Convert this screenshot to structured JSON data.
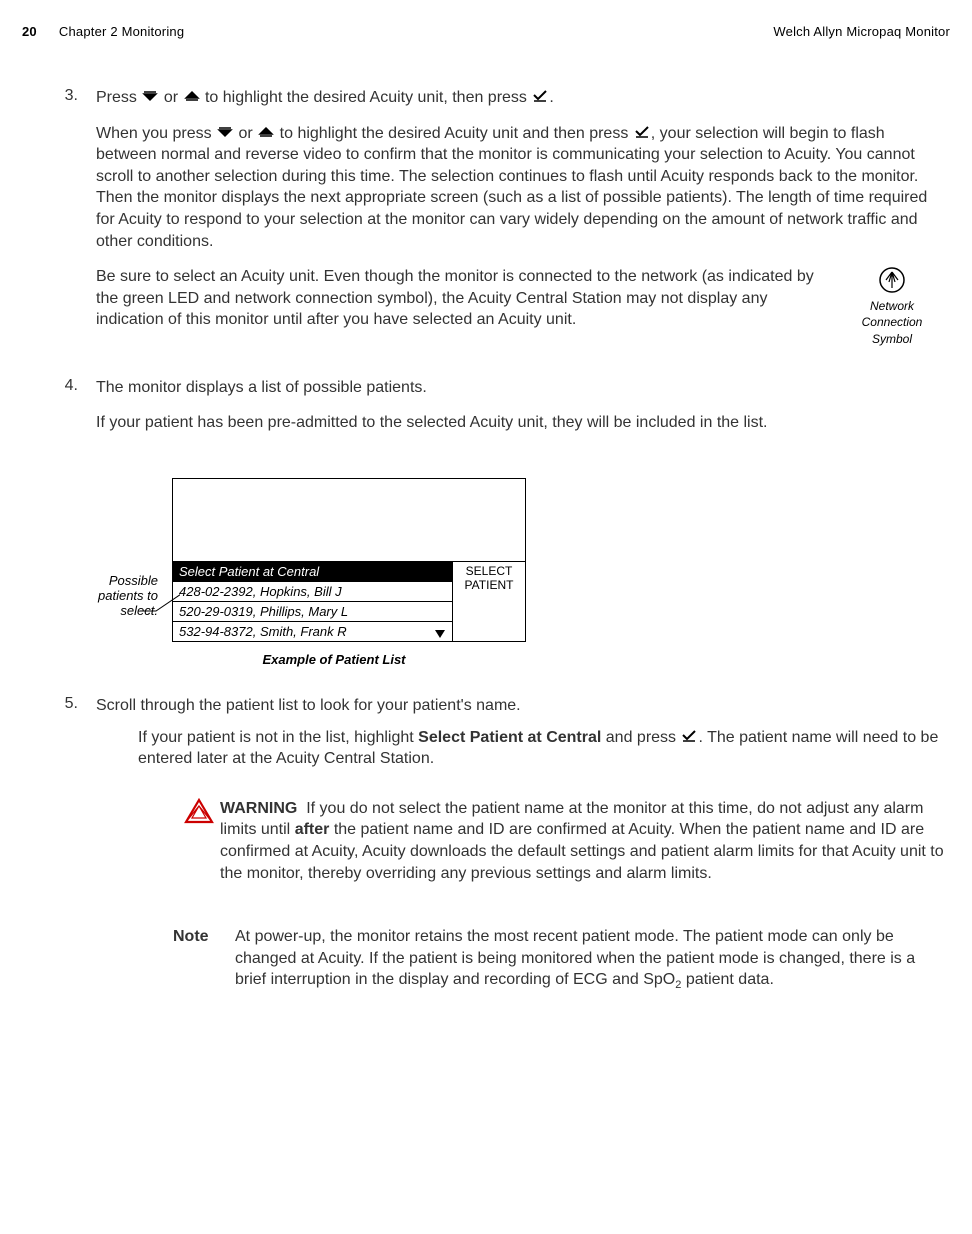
{
  "header": {
    "page_num": "20",
    "chapter": "Chapter 2   Monitoring",
    "product": "Welch Allyn Micropaq Monitor"
  },
  "step3": {
    "num": "3.",
    "line1_a": "Press",
    "line1_b": "or",
    "line1_c": "to highlight the desired Acuity unit, then press",
    "line1_d": ".",
    "para2_a": "When you press",
    "para2_b": "or",
    "para2_c": " to highlight the desired Acuity unit and then press",
    "para2_d": ", your selection will begin to flash between normal and reverse video to confirm that the monitor is communicating your selection to Acuity. You cannot scroll to another selection during this time. The selection continues to flash until Acuity responds back to the monitor. Then the monitor displays the next appropriate screen (such as a list of possible patients). The length of time required for Acuity to respond to your selection at the monitor can vary widely depending on the amount of network traffic and other conditions.",
    "para3": "Be sure to select an Acuity unit. Even though the monitor is connected to the network (as indicated by the green LED and network connection symbol), the Acuity Central Station may not display any indication of this monitor until after you have selected an Acuity unit."
  },
  "netconn": {
    "label_line1": "Network Connection",
    "label_line2": "Symbol"
  },
  "step4": {
    "num": "4.",
    "line1": "The monitor displays a list of possible patients.",
    "para2": "If your patient has been pre-admitted to the selected Acuity unit, they will be included in the list."
  },
  "patient_list": {
    "title": "Select Patient at Central",
    "rows": [
      "428-02-2392, Hopkins, Bill J",
      "520-29-0319, Phillips, Mary L",
      "532-94-8372, Smith, Frank R"
    ],
    "side_line1": "SELECT",
    "side_line2": "PATIENT",
    "caption": "Example of Patient List",
    "callout_line1": "Possible",
    "callout_line2": "patients to",
    "callout_line3": "select."
  },
  "step5": {
    "num": "5.",
    "line1": "Scroll through the patient list to look for your patient's name.",
    "para2_a": "If your patient is not in the list, highlight ",
    "para2_bold": "Select Patient at Central",
    "para2_b": " and press ",
    "para2_c": ". The patient name will need to be entered later at the Acuity Central Station."
  },
  "warning": {
    "label": "WARNING",
    "text_a": "If you do not select the patient name at the monitor at this time, do not adjust any alarm limits until ",
    "text_bold": "after",
    "text_b": " the patient name and ID are confirmed at Acuity. When the patient name and ID are confirmed at Acuity, Acuity downloads the default settings and patient alarm limits for that Acuity unit to the monitor, thereby overriding any previous settings and alarm limits."
  },
  "note": {
    "label": "Note",
    "text_a": "At power-up, the monitor retains the most recent patient mode. The patient mode can only be changed at Acuity. If the patient is being monitored when the patient mode is changed, there is a brief interruption in the display and recording of ECG and SpO",
    "text_b": " patient data.",
    "sub": "2"
  }
}
